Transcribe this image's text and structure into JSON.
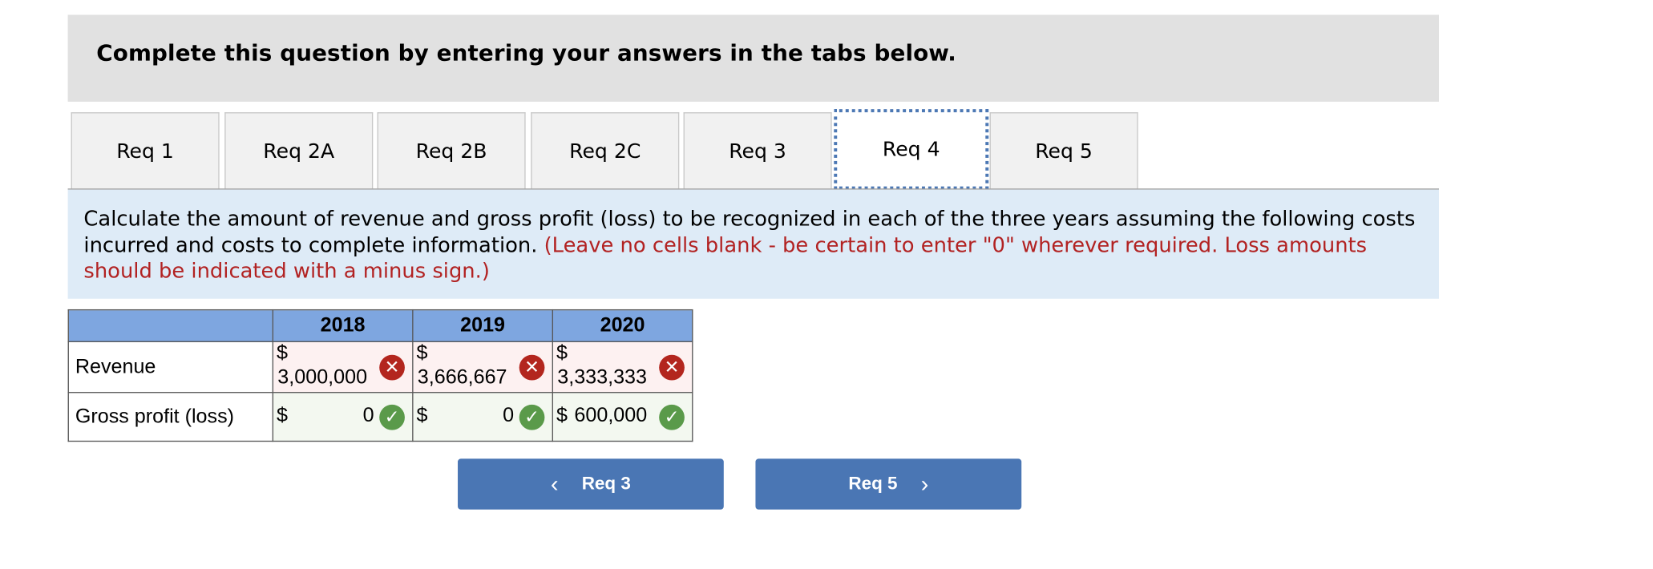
{
  "header": {
    "title": "Complete this question by entering your answers in the tabs below."
  },
  "tabs": [
    {
      "label": "Req 1"
    },
    {
      "label": "Req 2A"
    },
    {
      "label": "Req 2B"
    },
    {
      "label": "Req 2C"
    },
    {
      "label": "Req 3"
    },
    {
      "label": "Req 4",
      "active": true
    },
    {
      "label": "Req 5"
    }
  ],
  "instructions": {
    "text": "Calculate the amount of revenue and gross profit (loss) to be recognized in each of the three years assuming the following costs incurred and costs to complete information. ",
    "note": "(Leave no cells blank - be certain to enter \"0\" wherever required. Loss amounts should be indicated with a minus sign.)"
  },
  "table": {
    "columns": [
      "",
      "2018",
      "2019",
      "2020"
    ],
    "rows": [
      {
        "label": "Revenue",
        "cells": [
          {
            "currency": "$",
            "value": "3,000,000",
            "status": "incorrect"
          },
          {
            "currency": "$",
            "value": "3,666,667",
            "status": "incorrect"
          },
          {
            "currency": "$",
            "value": "3,333,333",
            "status": "incorrect"
          }
        ]
      },
      {
        "label": "Gross profit (loss)",
        "cells": [
          {
            "currency": "$",
            "value": "0",
            "status": "correct"
          },
          {
            "currency": "$",
            "value": "0",
            "status": "correct"
          },
          {
            "currency": "$",
            "value": "600,000",
            "status": "correct"
          }
        ]
      }
    ]
  },
  "nav": {
    "prev_label": "Req 3",
    "next_label": "Req 5",
    "prev_icon": "chevron-left-icon",
    "next_icon": "chevron-right-icon"
  },
  "colors": {
    "header_bg": "#e1e1e1",
    "instructions_bg": "#deebf7",
    "note_text": "#b22222",
    "table_header_bg": "#7ea6e0",
    "incorrect_badge": "#b3261e",
    "correct_badge": "#5a9a4a",
    "button_bg": "#4a76b4"
  }
}
